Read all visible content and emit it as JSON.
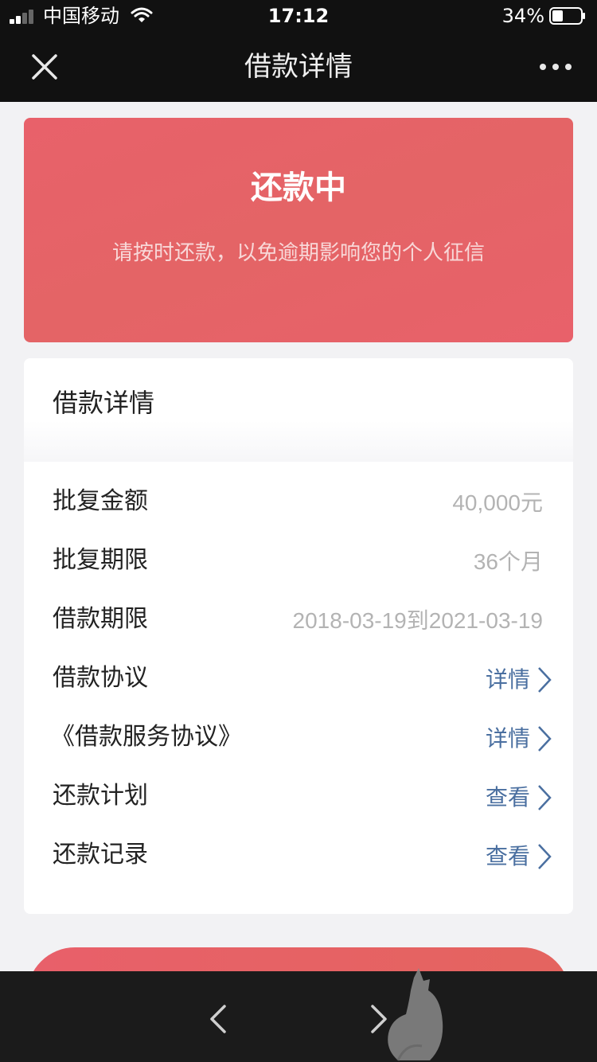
{
  "status_bar": {
    "carrier": "中国移动",
    "time": "17:12",
    "battery": "34%"
  },
  "nav": {
    "title": "借款详情",
    "close_icon": "close-icon",
    "more_icon": "more-icon"
  },
  "status_card": {
    "title": "还款中",
    "subtitle": "请按时还款，以免逾期影响您的个人征信"
  },
  "details": {
    "section_title": "借款详情",
    "rows": [
      {
        "label": "批复金额",
        "value": "40,000元"
      },
      {
        "label": "批复期限",
        "value": "36个月"
      },
      {
        "label": "借款期限",
        "value": "2018-03-19到2021-03-19"
      },
      {
        "label": "借款协议",
        "link": "详情"
      },
      {
        "label": "《借款服务协议》",
        "link": "详情"
      },
      {
        "label": "还款计划",
        "link": "查看"
      },
      {
        "label": "还款记录",
        "link": "查看"
      }
    ]
  },
  "colors": {
    "accent": "#e8616a",
    "link": "#4a6fa0",
    "value_gray": "#b3b3b3",
    "bar_dark": "#111111"
  }
}
